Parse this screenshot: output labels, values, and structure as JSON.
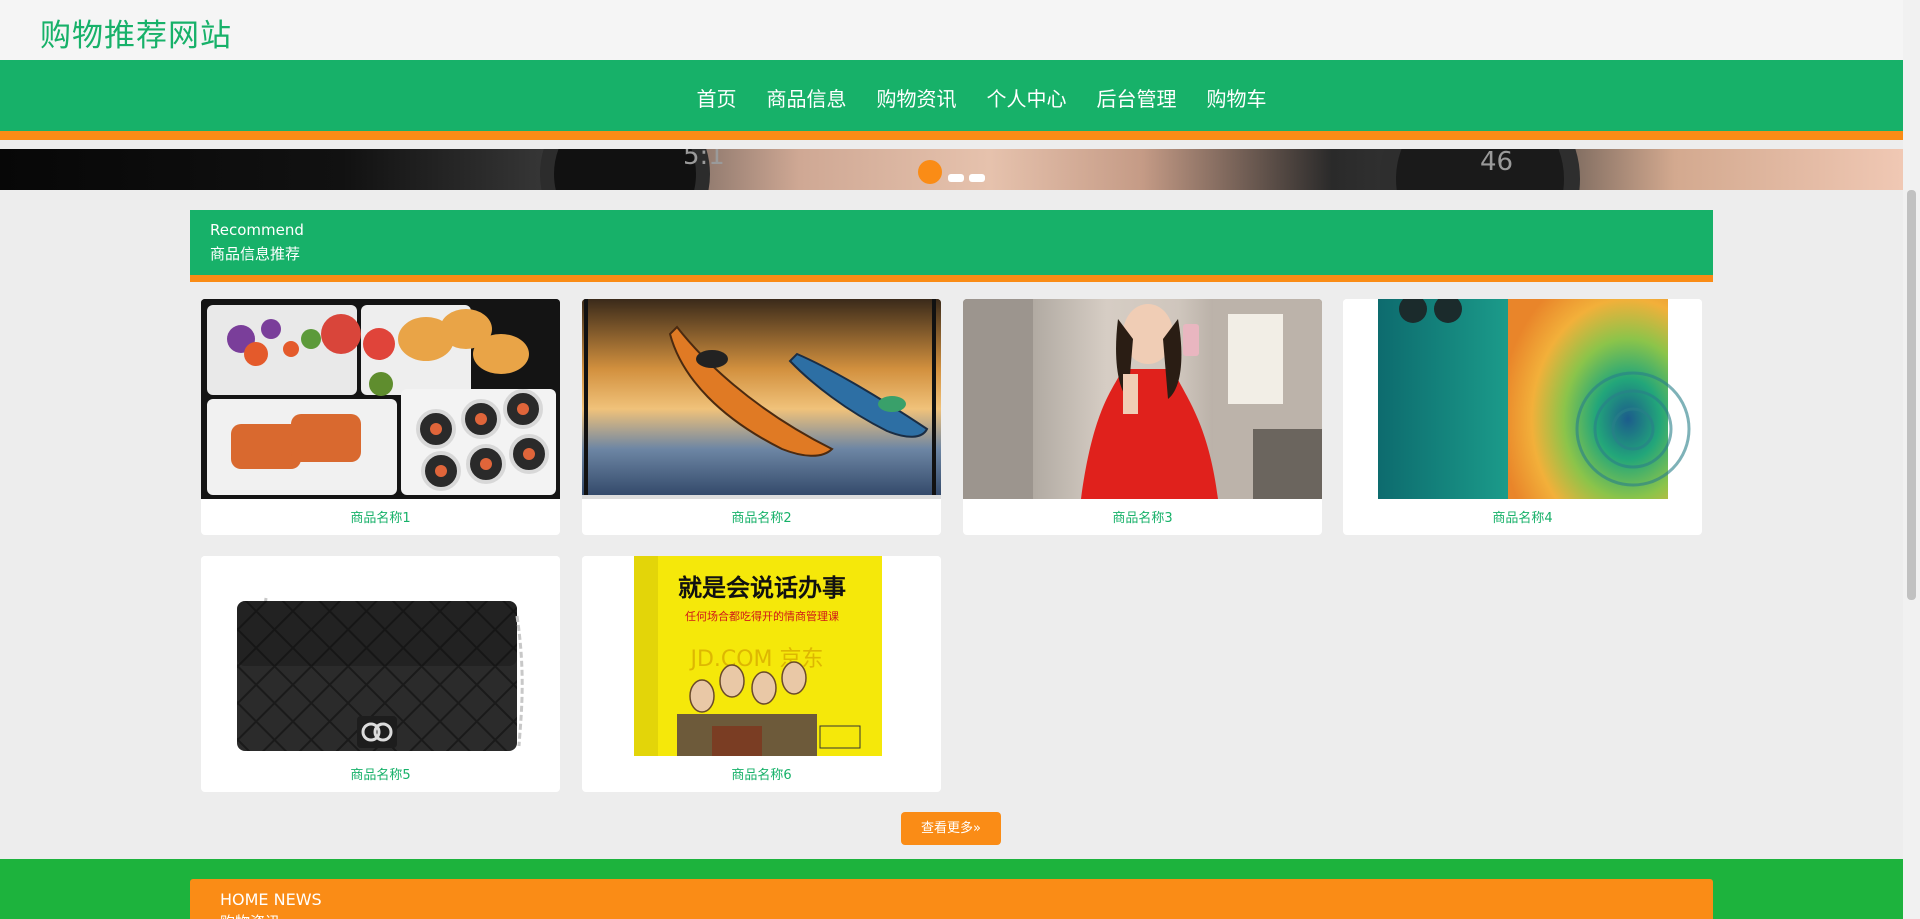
{
  "site": {
    "title": "购物推荐网站"
  },
  "nav": {
    "items": [
      {
        "label": "首页"
      },
      {
        "label": "商品信息"
      },
      {
        "label": "购物资讯"
      },
      {
        "label": "个人中心"
      },
      {
        "label": "后台管理"
      },
      {
        "label": "购物车"
      }
    ]
  },
  "banner": {
    "text_left": "5:1",
    "text_right": "46",
    "dots": 3,
    "active_dot": 1
  },
  "recommend": {
    "title_en": "Recommend",
    "title_cn": "商品信息推荐",
    "products": [
      {
        "name": "商品名称1",
        "image": "bento-box"
      },
      {
        "name": "商品名称2",
        "image": "kayaks"
      },
      {
        "name": "商品名称3",
        "image": "woman-red-dress"
      },
      {
        "name": "商品名称4",
        "image": "smartphone"
      },
      {
        "name": "商品名称5",
        "image": "quilted-handbag"
      },
      {
        "name": "商品名称6",
        "image": "book-cover"
      }
    ],
    "more_label": "查看更多»"
  },
  "book": {
    "title": "就是会说话办事",
    "subtitle": "任何场合都吃得开的情商管理课",
    "watermark": "JD.COM 京东"
  },
  "news": {
    "title_en": "HOME NEWS",
    "title_cn": "购物资讯"
  },
  "colors": {
    "primary_green": "#17b169",
    "accent_orange": "#fa8c16",
    "page_bg": "#ededed"
  }
}
